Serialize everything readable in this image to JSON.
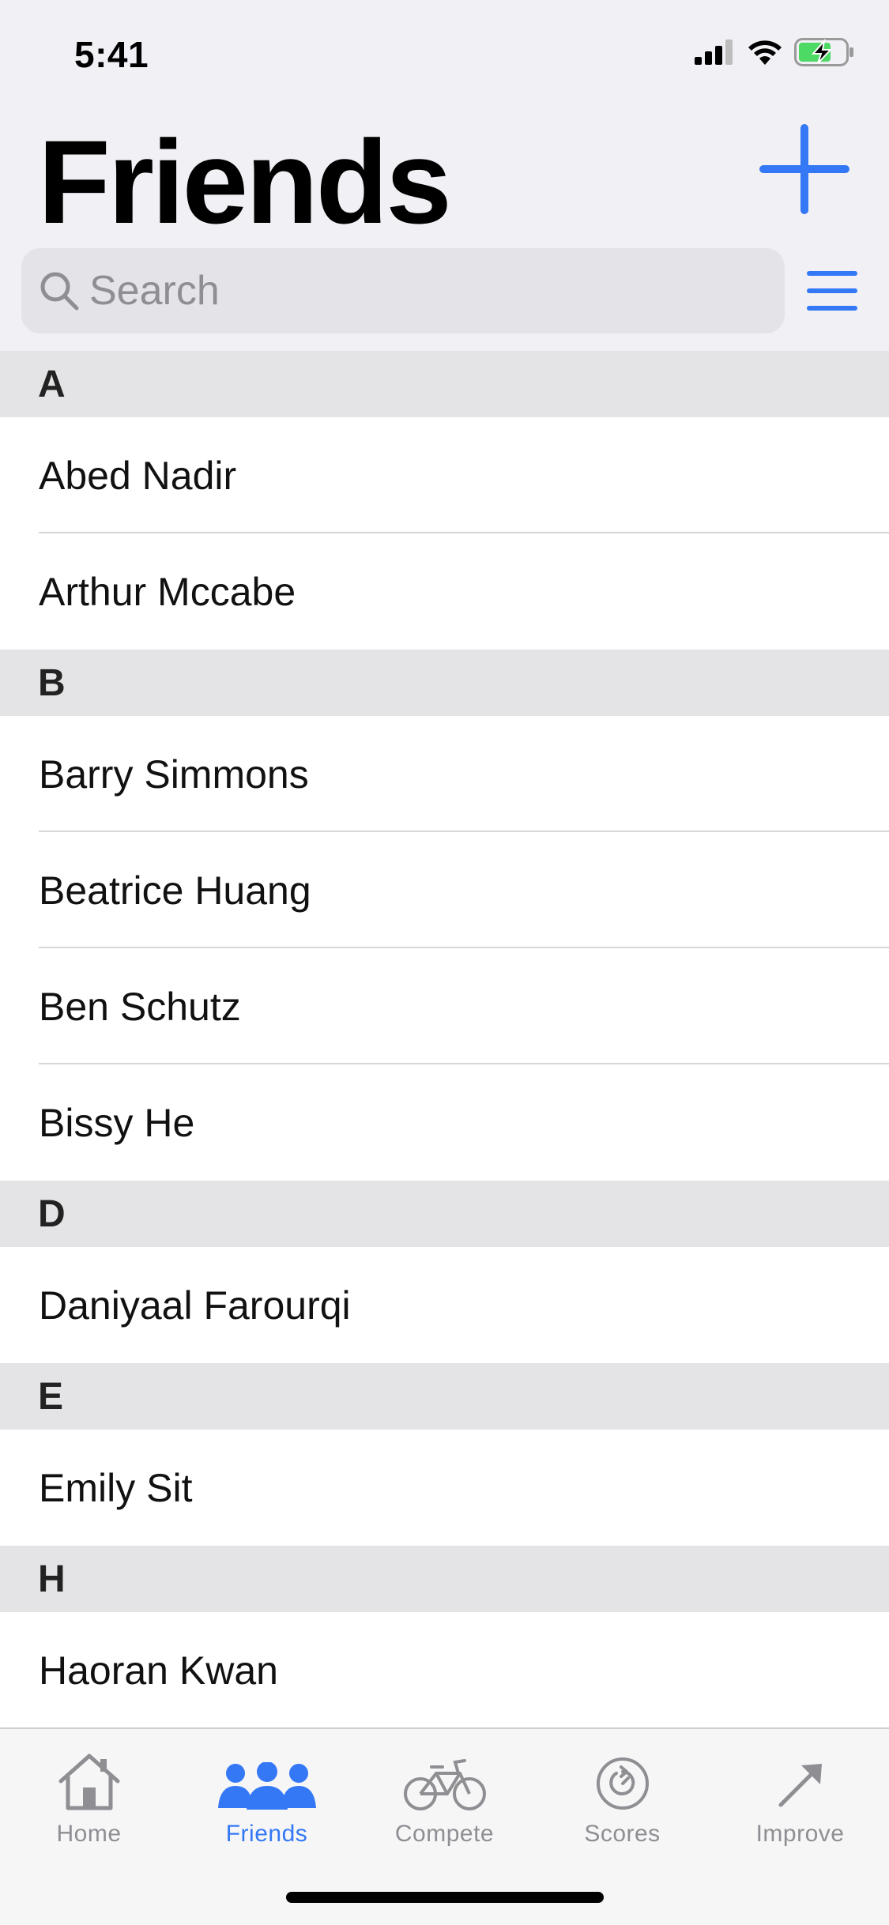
{
  "status_bar": {
    "time": "5:41"
  },
  "header": {
    "title": "Friends"
  },
  "search": {
    "placeholder": "Search"
  },
  "sections": [
    {
      "letter": "A",
      "friends": [
        "Abed Nadir",
        "Arthur Mccabe"
      ]
    },
    {
      "letter": "B",
      "friends": [
        "Barry Simmons",
        "Beatrice Huang",
        "Ben Schutz",
        "Bissy He"
      ]
    },
    {
      "letter": "D",
      "friends": [
        "Daniyaal Farourqi"
      ]
    },
    {
      "letter": "E",
      "friends": [
        "Emily Sit"
      ]
    },
    {
      "letter": "H",
      "friends": [
        "Haoran Kwan"
      ]
    }
  ],
  "tab_bar": {
    "tabs": [
      {
        "label": "Home",
        "icon": "house-icon",
        "active": false
      },
      {
        "label": "Friends",
        "icon": "people-icon",
        "active": true
      },
      {
        "label": "Compete",
        "icon": "bicycle-icon",
        "active": false
      },
      {
        "label": "Scores",
        "icon": "rewind-circle-icon",
        "active": false
      },
      {
        "label": "Improve",
        "icon": "arrow-up-right-icon",
        "active": false
      }
    ]
  },
  "colors": {
    "accent": "#3478f6",
    "inactive": "#8e8e93",
    "section_bg": "#e4e4e6",
    "battery_green": "#4cd964"
  }
}
